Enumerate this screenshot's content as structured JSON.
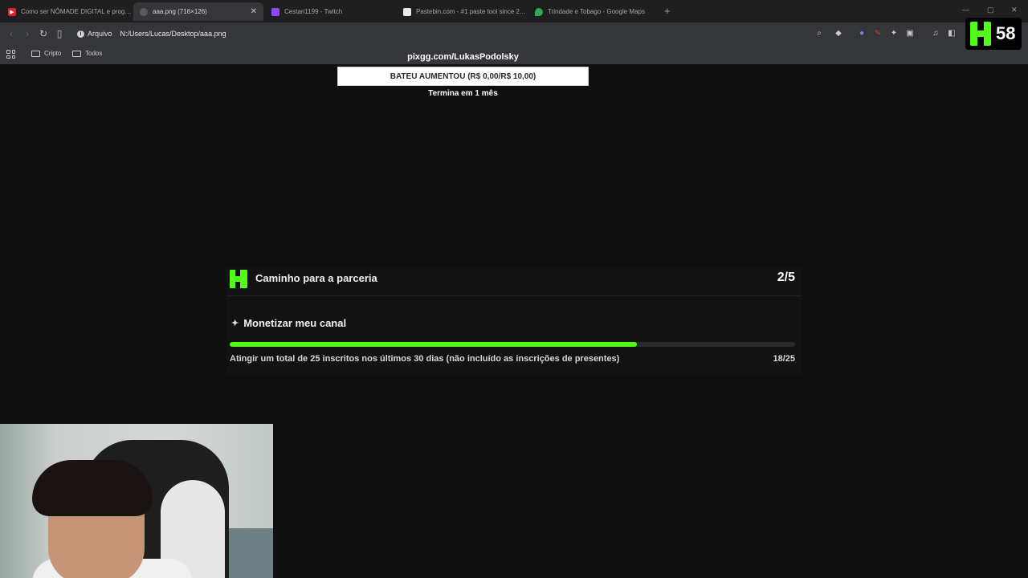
{
  "browser": {
    "tabs": [
      {
        "title": "Como ser NÔMADE DIGITAL e prog…",
        "favicon": "youtube-icon",
        "active": false
      },
      {
        "title": "aaa.png (716×126)",
        "favicon": "image-file-icon",
        "active": true
      },
      {
        "title": "Cestari1199 - Twitch",
        "favicon": "twitch-icon",
        "active": false
      },
      {
        "title": "Pastebin.com - #1 paste tool since 2…",
        "favicon": "pastebin-icon",
        "active": false
      },
      {
        "title": "Trindade e Tobago - Google Maps",
        "favicon": "maps-pin-icon",
        "active": false
      }
    ],
    "address": {
      "scheme_label": "Arquivo",
      "path": "N:/Users/Lucas/Desktop/aaa.png"
    },
    "bookmarks": [
      {
        "label": "Cripto",
        "icon": "folder-icon"
      },
      {
        "label": "Todos",
        "icon": "folder-icon"
      }
    ]
  },
  "kick_badge": {
    "count": "58",
    "accent": "#53fc18"
  },
  "goal": {
    "url": "pixgg.com/LukasPodolsky",
    "box_text": "BATEU AUMENTOU (R$ 0,00/R$ 10,00)",
    "subtitle": "Termina em 1 mês"
  },
  "partnership": {
    "title": "Caminho para a parceria",
    "step": "2/5",
    "task_title": "Monetizar meu canal",
    "task_description": "Atingir um total de 25 inscritos nos últimos 30 dias (não incluído as inscrições de presentes)",
    "task_count": "18/25",
    "progress_fraction": 0.72,
    "accent": "#53fc18"
  }
}
